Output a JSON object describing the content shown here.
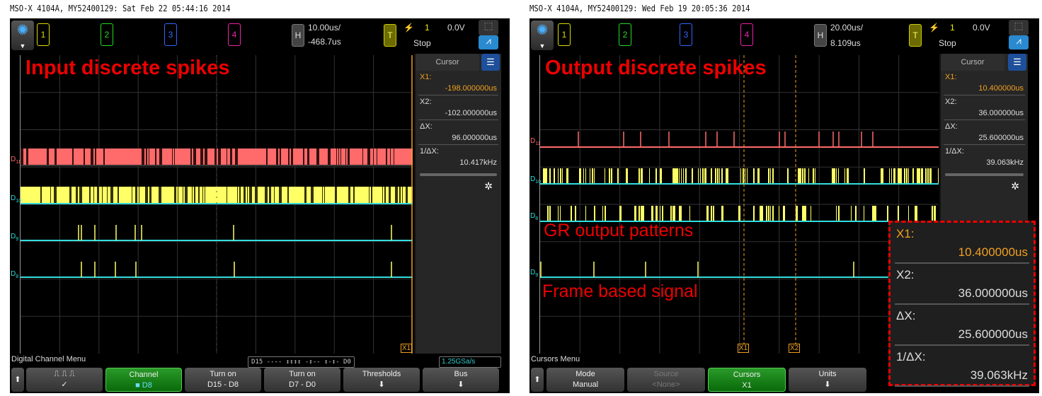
{
  "left": {
    "header": "MSO-X 4104A, MY52400129: Sat Feb 22 05:44:16 2014",
    "channels": [
      "1",
      "2",
      "3",
      "4"
    ],
    "horizontal": {
      "label": "H",
      "scale": "10.00us/",
      "delay": "-468.7us"
    },
    "trigger": {
      "label": "T",
      "source": "1",
      "level": "0.0V",
      "status": "Stop"
    },
    "annotation": "Input discrete spikes",
    "cursor_panel": {
      "title": "Cursor",
      "x1_label": "X1:",
      "x1": "-198.000000us",
      "x2_label": "X2:",
      "x2": "-102.000000us",
      "dx_label": "ΔX:",
      "dx": "96.000000us",
      "inv_label": "1/ΔX:",
      "inv": "10.417kHz"
    },
    "traces": [
      {
        "label": "D",
        "sub": "11",
        "color": "#ff6a6a"
      },
      {
        "label": "D",
        "sub": "10",
        "color": "#33dddd"
      },
      {
        "label": "D",
        "sub": "9",
        "color": "#33dddd"
      },
      {
        "label": "D",
        "sub": "8",
        "color": "#33dddd"
      }
    ],
    "cursor_marker": "X1",
    "menu_title": "Digital Channel Menu",
    "digital_status": "D15 ‐‐‐‐ ↕↕↕↕ ‐↕‐‐ ↕‐↕‐ D0",
    "sample_rate": "1.25GSa/s",
    "softkeys": [
      {
        "line1": "⎍   ⎍   ⎍",
        "line2": "✓"
      },
      {
        "line1": "Channel",
        "line2": "■ D8"
      },
      {
        "line1": "Turn on",
        "line2": "D15 - D8"
      },
      {
        "line1": "Turn on",
        "line2": "D7 - D0"
      },
      {
        "line1": "Thresholds",
        "line2": "⬇"
      },
      {
        "line1": "Bus",
        "line2": "⬇"
      }
    ]
  },
  "right": {
    "header": "MSO-X 4104A, MY52400129: Wed Feb 19 20:05:36 2014",
    "channels": [
      "1",
      "2",
      "3",
      "4"
    ],
    "horizontal": {
      "label": "H",
      "scale": "20.00us/",
      "delay": "8.109us"
    },
    "trigger": {
      "label": "T",
      "source": "1",
      "level": "0.0V",
      "status": "Stop"
    },
    "annotations": [
      "Output discrete spikes",
      "GR output patterns",
      "Frame based signal"
    ],
    "cursor_panel": {
      "title": "Cursor",
      "x1_label": "X1:",
      "x1": "10.400000us",
      "x2_label": "X2:",
      "x2": "36.000000us",
      "dx_label": "ΔX:",
      "dx": "25.600000us",
      "inv_label": "1/ΔX:",
      "inv": "39.063kHz"
    },
    "traces": [
      {
        "label": "D",
        "sub": "11",
        "color": "#ff6a6a"
      },
      {
        "label": "D",
        "sub": "10",
        "color": "#33dddd"
      },
      {
        "label": "D",
        "sub": "8",
        "color": "#33dddd"
      },
      {
        "label": "D",
        "sub": "9",
        "color": "#33dddd"
      }
    ],
    "cursor_markers": [
      "X1",
      "X2"
    ],
    "menu_title": "Cursors Menu",
    "softkeys": [
      {
        "line1": "Mode",
        "line2": "Manual"
      },
      {
        "line1": "Source",
        "line2": "<None>"
      },
      {
        "line1": "Cursors",
        "line2": "X1"
      },
      {
        "line1": "Units",
        "line2": "⬇"
      }
    ]
  },
  "colors": {
    "d11": "#ff6a6a",
    "digital": "#ffff66",
    "baseline": "#33dddd",
    "cursor": "#f0a020",
    "annotation": "#ee0000"
  }
}
